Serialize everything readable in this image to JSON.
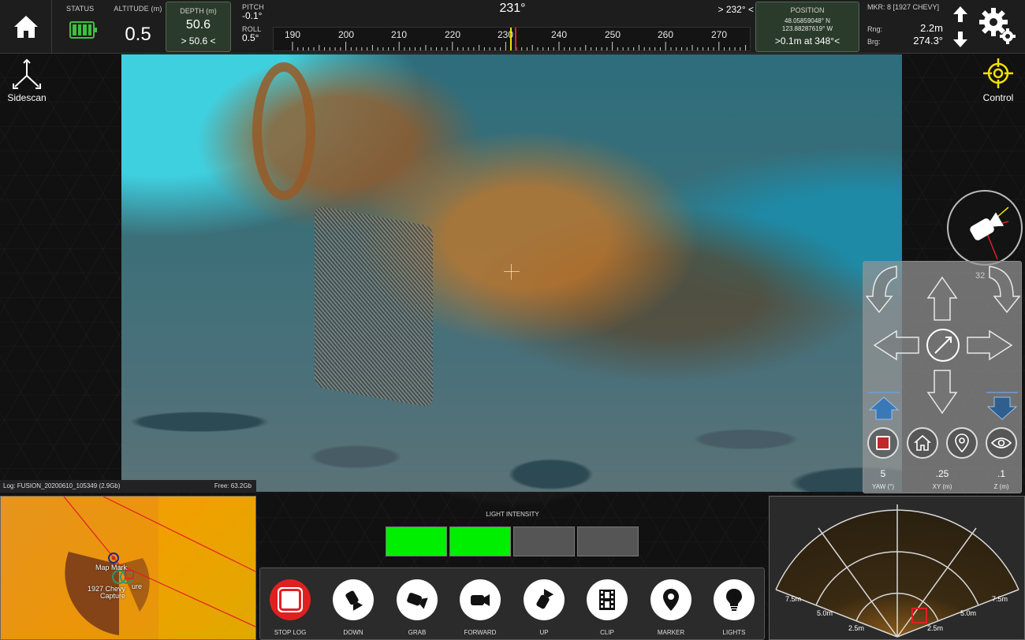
{
  "topbar": {
    "status_label": "STATUS",
    "altitude_label": "ALTITUDE (m)",
    "altitude_value": "0.5",
    "depth_label": "DEPTH (m)",
    "depth_value": "50.6",
    "depth_target": "> 50.6 <",
    "pitch_label": "PITCH",
    "pitch_value": "-0.1°",
    "roll_label": "ROLL",
    "roll_value": "0.5°",
    "heading_value": "231°",
    "heading_target": "> 232° <",
    "compass_ticks": [
      "190",
      "200",
      "210",
      "220",
      "230",
      "240",
      "250",
      "260",
      "270"
    ],
    "position_label": "POSITION",
    "position_lat": "48.05859048° N",
    "position_lon": "123.88287619° W",
    "position_dist": ">0.1m at 348°<",
    "marker_label": "MKR: 8 [1927 CHEVY]",
    "rng_label": "Rng:",
    "rng_value": "2.2m",
    "brg_label": "Brg:",
    "brg_value": "274.3°",
    "battery_level": 1.0
  },
  "side": {
    "sidescan_label": "Sidescan",
    "control_label": "Control"
  },
  "control_panel": {
    "heading_hint": "32",
    "yaw_value": "5",
    "yaw_unit": "YAW (°)",
    "xy_value": ".25",
    "xy_unit": "XY (m)",
    "z_value": ".1",
    "z_unit": "Z (m)"
  },
  "log": {
    "file": "Log: FUSION_20200610_105349 (2.9Gb)",
    "free": "Free: 63.2Gb"
  },
  "minimap": {
    "label_1": "Map Mark",
    "label_2": "1927 Chevy",
    "label_3": "Capture",
    "label_4": "ure"
  },
  "lights": {
    "title": "LIGHT INTENSITY",
    "level": 2,
    "segments": 4
  },
  "toolbar": {
    "stop_log": "STOP LOG",
    "down": "DOWN",
    "grab": "GRAB",
    "forward": "FORWARD",
    "up": "UP",
    "clip": "CLIP",
    "marker": "MARKER",
    "lights": "LIGHTS"
  },
  "sonar": {
    "ranges": [
      "7.5m",
      "5.0m",
      "2.5m",
      "2.5m",
      "5.0m",
      "7.5m"
    ]
  },
  "colors": {
    "accent_green": "#00ee00",
    "stop_red": "#e02020",
    "target_yellow": "#f2e000"
  }
}
